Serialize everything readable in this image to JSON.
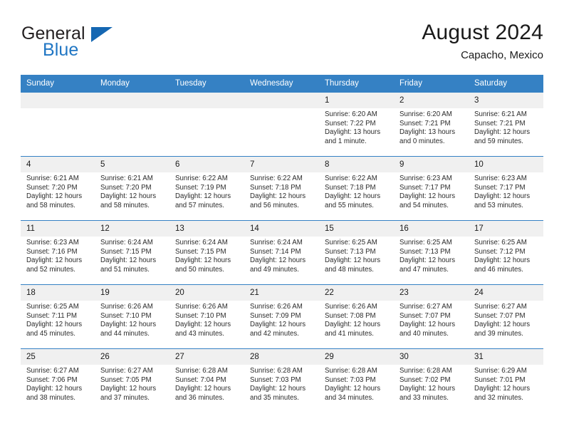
{
  "brand": {
    "name_part1": "General",
    "name_part2": "Blue",
    "logo_icon": "blue-triangle-logo"
  },
  "header": {
    "month_title": "August 2024",
    "location": "Capacho, Mexico"
  },
  "calendar": {
    "weekday_headers": [
      "Sunday",
      "Monday",
      "Tuesday",
      "Wednesday",
      "Thursday",
      "Friday",
      "Saturday"
    ],
    "accent_color": "#3581c4",
    "daynum_band_color": "#f0f0f0",
    "weeks": [
      [
        {
          "day": "",
          "empty": true
        },
        {
          "day": "",
          "empty": true
        },
        {
          "day": "",
          "empty": true
        },
        {
          "day": "",
          "empty": true
        },
        {
          "day": "1",
          "sunrise": "Sunrise: 6:20 AM",
          "sunset": "Sunset: 7:22 PM",
          "daylight": "Daylight: 13 hours and 1 minute."
        },
        {
          "day": "2",
          "sunrise": "Sunrise: 6:20 AM",
          "sunset": "Sunset: 7:21 PM",
          "daylight": "Daylight: 13 hours and 0 minutes."
        },
        {
          "day": "3",
          "sunrise": "Sunrise: 6:21 AM",
          "sunset": "Sunset: 7:21 PM",
          "daylight": "Daylight: 12 hours and 59 minutes."
        }
      ],
      [
        {
          "day": "4",
          "sunrise": "Sunrise: 6:21 AM",
          "sunset": "Sunset: 7:20 PM",
          "daylight": "Daylight: 12 hours and 58 minutes."
        },
        {
          "day": "5",
          "sunrise": "Sunrise: 6:21 AM",
          "sunset": "Sunset: 7:20 PM",
          "daylight": "Daylight: 12 hours and 58 minutes."
        },
        {
          "day": "6",
          "sunrise": "Sunrise: 6:22 AM",
          "sunset": "Sunset: 7:19 PM",
          "daylight": "Daylight: 12 hours and 57 minutes."
        },
        {
          "day": "7",
          "sunrise": "Sunrise: 6:22 AM",
          "sunset": "Sunset: 7:18 PM",
          "daylight": "Daylight: 12 hours and 56 minutes."
        },
        {
          "day": "8",
          "sunrise": "Sunrise: 6:22 AM",
          "sunset": "Sunset: 7:18 PM",
          "daylight": "Daylight: 12 hours and 55 minutes."
        },
        {
          "day": "9",
          "sunrise": "Sunrise: 6:23 AM",
          "sunset": "Sunset: 7:17 PM",
          "daylight": "Daylight: 12 hours and 54 minutes."
        },
        {
          "day": "10",
          "sunrise": "Sunrise: 6:23 AM",
          "sunset": "Sunset: 7:17 PM",
          "daylight": "Daylight: 12 hours and 53 minutes."
        }
      ],
      [
        {
          "day": "11",
          "sunrise": "Sunrise: 6:23 AM",
          "sunset": "Sunset: 7:16 PM",
          "daylight": "Daylight: 12 hours and 52 minutes."
        },
        {
          "day": "12",
          "sunrise": "Sunrise: 6:24 AM",
          "sunset": "Sunset: 7:15 PM",
          "daylight": "Daylight: 12 hours and 51 minutes."
        },
        {
          "day": "13",
          "sunrise": "Sunrise: 6:24 AM",
          "sunset": "Sunset: 7:15 PM",
          "daylight": "Daylight: 12 hours and 50 minutes."
        },
        {
          "day": "14",
          "sunrise": "Sunrise: 6:24 AM",
          "sunset": "Sunset: 7:14 PM",
          "daylight": "Daylight: 12 hours and 49 minutes."
        },
        {
          "day": "15",
          "sunrise": "Sunrise: 6:25 AM",
          "sunset": "Sunset: 7:13 PM",
          "daylight": "Daylight: 12 hours and 48 minutes."
        },
        {
          "day": "16",
          "sunrise": "Sunrise: 6:25 AM",
          "sunset": "Sunset: 7:13 PM",
          "daylight": "Daylight: 12 hours and 47 minutes."
        },
        {
          "day": "17",
          "sunrise": "Sunrise: 6:25 AM",
          "sunset": "Sunset: 7:12 PM",
          "daylight": "Daylight: 12 hours and 46 minutes."
        }
      ],
      [
        {
          "day": "18",
          "sunrise": "Sunrise: 6:25 AM",
          "sunset": "Sunset: 7:11 PM",
          "daylight": "Daylight: 12 hours and 45 minutes."
        },
        {
          "day": "19",
          "sunrise": "Sunrise: 6:26 AM",
          "sunset": "Sunset: 7:10 PM",
          "daylight": "Daylight: 12 hours and 44 minutes."
        },
        {
          "day": "20",
          "sunrise": "Sunrise: 6:26 AM",
          "sunset": "Sunset: 7:10 PM",
          "daylight": "Daylight: 12 hours and 43 minutes."
        },
        {
          "day": "21",
          "sunrise": "Sunrise: 6:26 AM",
          "sunset": "Sunset: 7:09 PM",
          "daylight": "Daylight: 12 hours and 42 minutes."
        },
        {
          "day": "22",
          "sunrise": "Sunrise: 6:26 AM",
          "sunset": "Sunset: 7:08 PM",
          "daylight": "Daylight: 12 hours and 41 minutes."
        },
        {
          "day": "23",
          "sunrise": "Sunrise: 6:27 AM",
          "sunset": "Sunset: 7:07 PM",
          "daylight": "Daylight: 12 hours and 40 minutes."
        },
        {
          "day": "24",
          "sunrise": "Sunrise: 6:27 AM",
          "sunset": "Sunset: 7:07 PM",
          "daylight": "Daylight: 12 hours and 39 minutes."
        }
      ],
      [
        {
          "day": "25",
          "sunrise": "Sunrise: 6:27 AM",
          "sunset": "Sunset: 7:06 PM",
          "daylight": "Daylight: 12 hours and 38 minutes."
        },
        {
          "day": "26",
          "sunrise": "Sunrise: 6:27 AM",
          "sunset": "Sunset: 7:05 PM",
          "daylight": "Daylight: 12 hours and 37 minutes."
        },
        {
          "day": "27",
          "sunrise": "Sunrise: 6:28 AM",
          "sunset": "Sunset: 7:04 PM",
          "daylight": "Daylight: 12 hours and 36 minutes."
        },
        {
          "day": "28",
          "sunrise": "Sunrise: 6:28 AM",
          "sunset": "Sunset: 7:03 PM",
          "daylight": "Daylight: 12 hours and 35 minutes."
        },
        {
          "day": "29",
          "sunrise": "Sunrise: 6:28 AM",
          "sunset": "Sunset: 7:03 PM",
          "daylight": "Daylight: 12 hours and 34 minutes."
        },
        {
          "day": "30",
          "sunrise": "Sunrise: 6:28 AM",
          "sunset": "Sunset: 7:02 PM",
          "daylight": "Daylight: 12 hours and 33 minutes."
        },
        {
          "day": "31",
          "sunrise": "Sunrise: 6:29 AM",
          "sunset": "Sunset: 7:01 PM",
          "daylight": "Daylight: 12 hours and 32 minutes."
        }
      ]
    ]
  }
}
